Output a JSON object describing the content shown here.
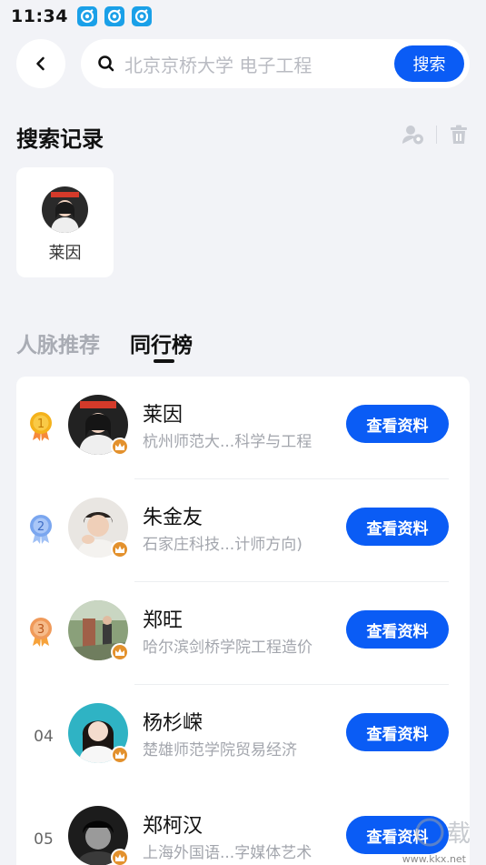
{
  "status_bar": {
    "time": "11:34",
    "app_icons": [
      "notification-app-icon",
      "notification-app-icon",
      "notification-app-icon"
    ]
  },
  "search": {
    "back_icon": "chevron-left-icon",
    "icon": "search-icon",
    "placeholder": "北京京桥大学 电子工程",
    "button_label": "搜索"
  },
  "history": {
    "title": "搜索记录",
    "action_icons": [
      "user-hide-icon",
      "trash-icon"
    ],
    "items": [
      {
        "name": "莱因"
      }
    ]
  },
  "tabs": [
    {
      "label": "人脉推荐",
      "active": false
    },
    {
      "label": "同行榜",
      "active": true
    }
  ],
  "ranking": {
    "button_label": "查看资料",
    "rows": [
      {
        "rank": "1",
        "name": "莱因",
        "school": "杭州师范大...科学与工程",
        "medal_color": "#f4b21c"
      },
      {
        "rank": "2",
        "name": "朱金友",
        "school": "石家庄科技...计师方向)",
        "medal_color": "#7aa6ef"
      },
      {
        "rank": "3",
        "name": "郑旺",
        "school": "哈尔滨剑桥学院工程造价",
        "medal_color": "#f09a5a"
      },
      {
        "rank": "04",
        "name": "杨杉嵘",
        "school": "楚雄师范学院贸易经济",
        "medal_color": ""
      },
      {
        "rank": "05",
        "name": "郑柯汉",
        "school": "上海外国语...字媒体艺术",
        "medal_color": ""
      }
    ]
  },
  "colors": {
    "accent": "#0a5cf5",
    "background": "#f2f3f7",
    "crown": "#e3912d"
  },
  "watermark": {
    "text": "www.kkx.net",
    "glyph": "载"
  }
}
